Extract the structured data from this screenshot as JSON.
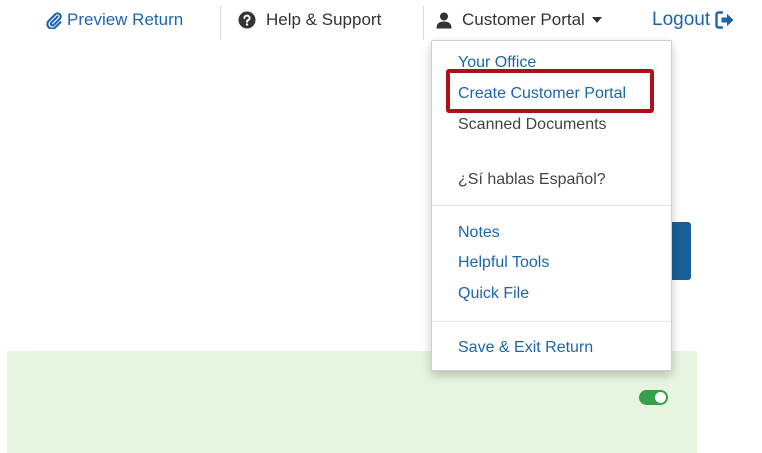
{
  "nav": {
    "preview_return": "Preview Return",
    "help_support": "Help & Support",
    "customer_portal": "Customer Portal",
    "logout": "Logout"
  },
  "dropdown": {
    "items": [
      {
        "label": "Your Office"
      },
      {
        "label": "Create Customer Portal"
      },
      {
        "label": "Scanned Documents"
      },
      {
        "label": "¿Sí hablas Español?"
      },
      {
        "label": "Notes"
      },
      {
        "label": "Helpful Tools"
      },
      {
        "label": "Quick File"
      },
      {
        "label": "Save & Exit Return"
      }
    ]
  },
  "colors": {
    "link_blue": "#1c65ad",
    "highlight_red": "#b00f16",
    "panel_green": "#e5f5df",
    "toggle_green": "#33a04a",
    "button_blue": "#1a5f97"
  },
  "icons": {
    "preview": "paperclip-icon",
    "help": "question-circle-icon",
    "portal": "user-icon",
    "caret": "caret-down-icon",
    "logout": "sign-out-icon"
  },
  "toggle": {
    "state": "on"
  }
}
